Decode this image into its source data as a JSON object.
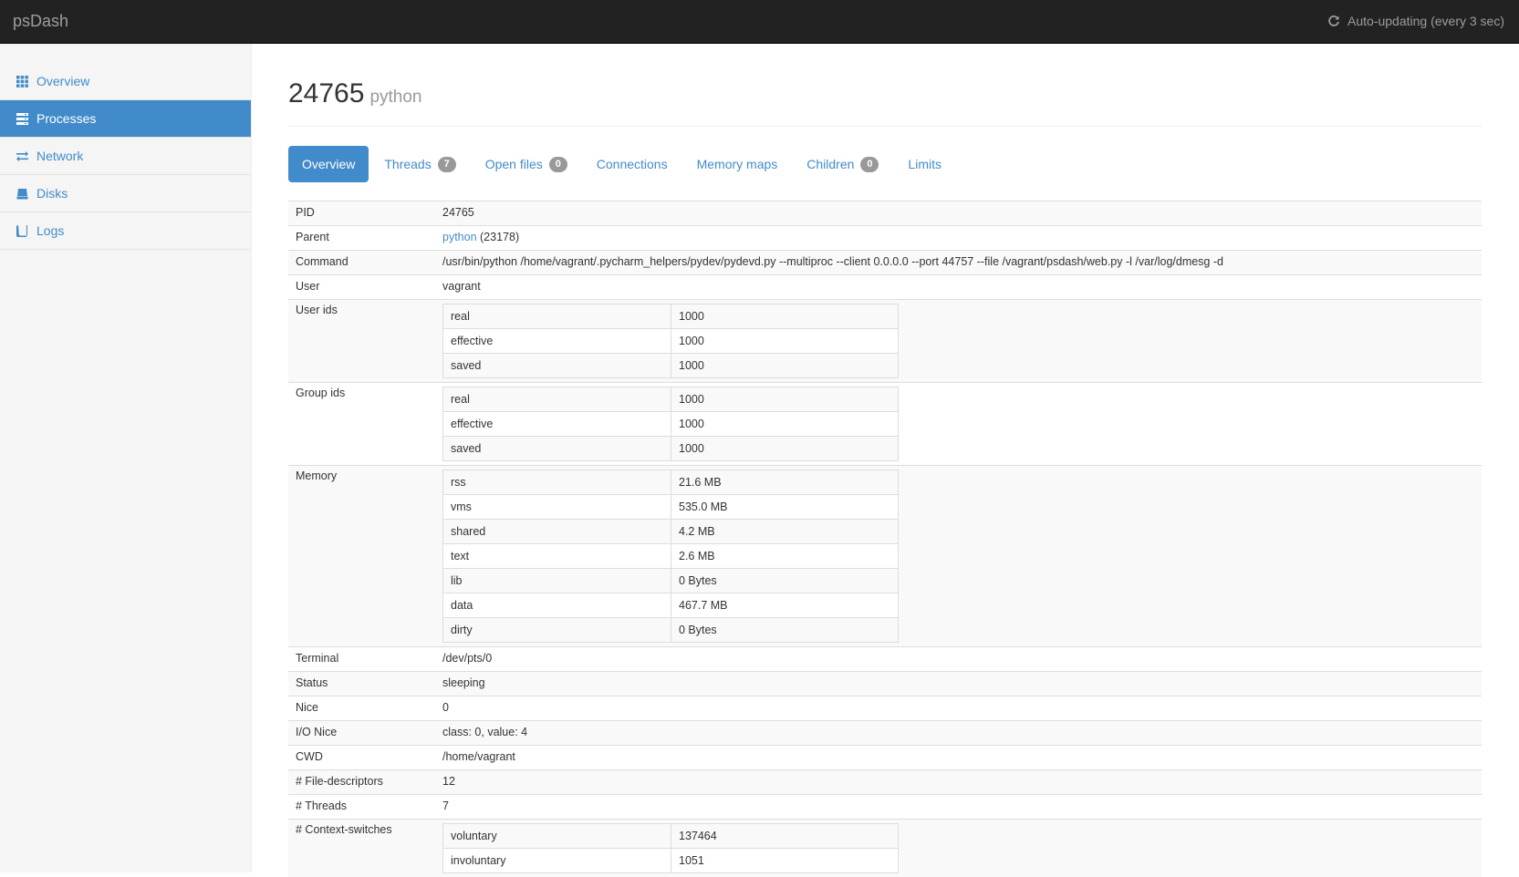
{
  "navbar": {
    "brand": "psDash",
    "auto_updating": "Auto-updating (every 3 sec)"
  },
  "sidebar": {
    "items": [
      {
        "label": "Overview",
        "icon": "grid-icon"
      },
      {
        "label": "Processes",
        "icon": "list-icon",
        "active": true
      },
      {
        "label": "Network",
        "icon": "transfer-icon"
      },
      {
        "label": "Disks",
        "icon": "disk-icon"
      },
      {
        "label": "Logs",
        "icon": "book-icon"
      }
    ]
  },
  "process": {
    "pid": "24765",
    "name": "python"
  },
  "tabs": [
    {
      "label": "Overview",
      "active": true
    },
    {
      "label": "Threads",
      "badge": "7"
    },
    {
      "label": "Open files",
      "badge": "0"
    },
    {
      "label": "Connections"
    },
    {
      "label": "Memory maps"
    },
    {
      "label": "Children",
      "badge": "0"
    },
    {
      "label": "Limits"
    }
  ],
  "details": {
    "pid": {
      "label": "PID",
      "value": "24765"
    },
    "parent": {
      "label": "Parent",
      "link": "python",
      "suffix": "(23178)"
    },
    "command": {
      "label": "Command",
      "value": "/usr/bin/python /home/vagrant/.pycharm_helpers/pydev/pydevd.py --multiproc --client 0.0.0.0 --port 44757 --file /vagrant/psdash/web.py -l /var/log/dmesg -d"
    },
    "user": {
      "label": "User",
      "value": "vagrant"
    },
    "user_ids": {
      "label": "User ids",
      "rows": [
        {
          "k": "real",
          "v": "1000"
        },
        {
          "k": "effective",
          "v": "1000"
        },
        {
          "k": "saved",
          "v": "1000"
        }
      ]
    },
    "group_ids": {
      "label": "Group ids",
      "rows": [
        {
          "k": "real",
          "v": "1000"
        },
        {
          "k": "effective",
          "v": "1000"
        },
        {
          "k": "saved",
          "v": "1000"
        }
      ]
    },
    "memory": {
      "label": "Memory",
      "rows": [
        {
          "k": "rss",
          "v": "21.6 MB"
        },
        {
          "k": "vms",
          "v": "535.0 MB"
        },
        {
          "k": "shared",
          "v": "4.2 MB"
        },
        {
          "k": "text",
          "v": "2.6 MB"
        },
        {
          "k": "lib",
          "v": "0 Bytes"
        },
        {
          "k": "data",
          "v": "467.7 MB"
        },
        {
          "k": "dirty",
          "v": "0 Bytes"
        }
      ]
    },
    "terminal": {
      "label": "Terminal",
      "value": "/dev/pts/0"
    },
    "status": {
      "label": "Status",
      "value": "sleeping"
    },
    "nice": {
      "label": "Nice",
      "value": "0"
    },
    "io_nice": {
      "label": "I/O Nice",
      "value": "class: 0, value: 4"
    },
    "cwd": {
      "label": "CWD",
      "value": "/home/vagrant"
    },
    "fds": {
      "label": "# File-descriptors",
      "value": "12"
    },
    "threads": {
      "label": "# Threads",
      "value": "7"
    },
    "ctx": {
      "label": "# Context-switches",
      "rows": [
        {
          "k": "voluntary",
          "v": "137464"
        },
        {
          "k": "involuntary",
          "v": "1051"
        }
      ]
    }
  }
}
